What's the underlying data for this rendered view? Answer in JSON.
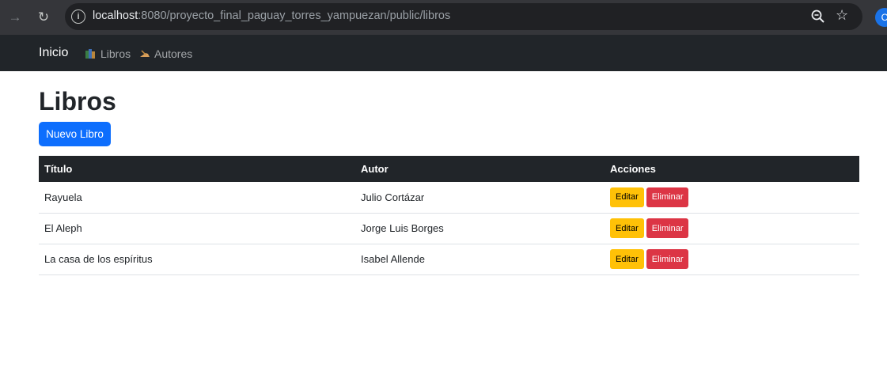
{
  "browser": {
    "url_host": "localhost",
    "url_rest": ":8080/proyecto_final_paguay_torres_yampuezan/public/libros",
    "profile_initial": "C"
  },
  "navbar": {
    "brand": "Inicio",
    "links": [
      {
        "label": "Libros",
        "icon": "books-icon"
      },
      {
        "label": "Autores",
        "icon": "writing-hand-icon"
      }
    ]
  },
  "main": {
    "title": "Libros",
    "new_button": "Nuevo Libro",
    "table": {
      "headers": [
        "Título",
        "Autor",
        "Acciones"
      ],
      "rows": [
        {
          "titulo": "Rayuela",
          "autor": "Julio Cortázar"
        },
        {
          "titulo": "El Aleph",
          "autor": "Jorge Luis Borges"
        },
        {
          "titulo": "La casa de los espíritus",
          "autor": "Isabel Allende"
        }
      ],
      "edit_label": "Editar",
      "delete_label": "Eliminar"
    }
  },
  "colors": {
    "primary": "#0d6efd",
    "warning": "#ffc107",
    "danger": "#dc3545",
    "dark": "#212529"
  }
}
